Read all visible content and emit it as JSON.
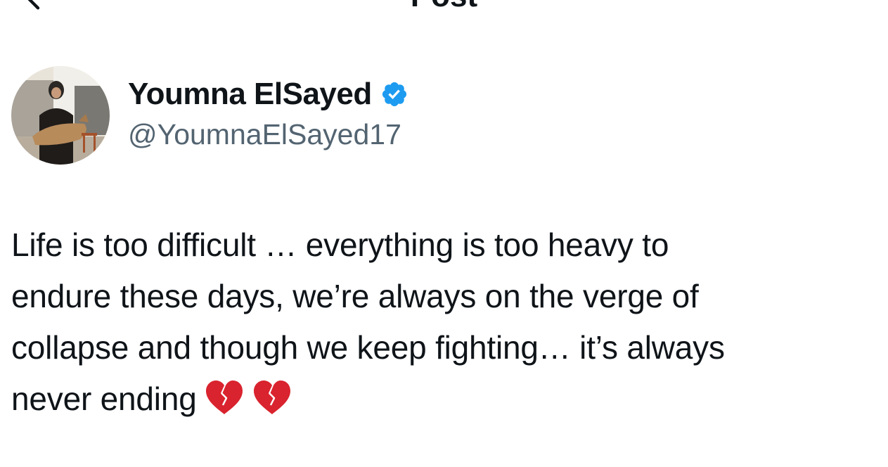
{
  "header": {
    "title": "Post",
    "back_icon": "chevron-left-icon"
  },
  "author": {
    "display_name": "Youmna ElSayed",
    "handle": "@YoumnaElSayed17",
    "verified_icon": "verified-badge-icon",
    "verified_color": "#1d9bf0"
  },
  "post": {
    "lines": [
      "Life is too difficult … everything is too heavy to",
      "endure these days, we’re always on the verge of",
      "collapse and though we keep fighting… it’s always",
      "never ending"
    ],
    "emoji": [
      "broken-heart-icon",
      "broken-heart-icon"
    ]
  },
  "colors": {
    "text": "#0f1419",
    "secondary_text": "#536471",
    "heart": "#d9232e"
  }
}
